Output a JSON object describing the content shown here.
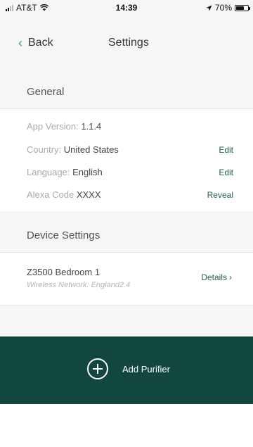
{
  "status_bar": {
    "carrier": "AT&T",
    "time": "14:39",
    "battery_percent": "70%",
    "battery_level": 0.7
  },
  "nav": {
    "back_label": "Back",
    "title": "Settings"
  },
  "general": {
    "header": "General",
    "app_version": {
      "label": "App Version:",
      "value": "1.1.4"
    },
    "country": {
      "label": "Country:",
      "value": "United States",
      "action": "Edit"
    },
    "language": {
      "label": "Language:",
      "value": "English",
      "action": "Edit"
    },
    "alexa_code": {
      "label": "Alexa Code",
      "value": "XXXX",
      "action": "Reveal"
    }
  },
  "device_settings": {
    "header": "Device Settings",
    "devices": [
      {
        "name": "Z3500 Bedroom 1",
        "network": "Wireless Network: England2.4",
        "action": "Details"
      }
    ]
  },
  "add_purifier": {
    "label": "Add Purifier"
  },
  "colors": {
    "accent_green": "#3ba35a",
    "brand_dark_green": "#12473f",
    "action_text": "#1e5f4e"
  }
}
